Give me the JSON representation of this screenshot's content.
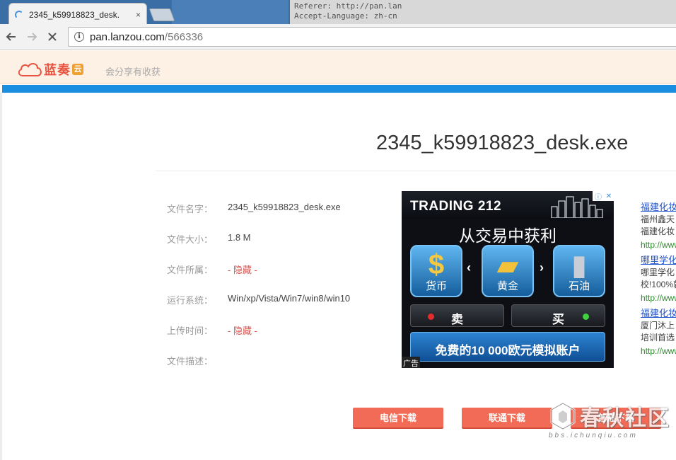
{
  "browser": {
    "tab_title": "2345_k59918823_desk.",
    "tab_close": "×",
    "url_host": "pan.lanzou.com",
    "url_path": "/566336",
    "desktop_text_line1": "Referer: http://pan.lan",
    "desktop_text_line2": "Accept-Language: zh-cn"
  },
  "site": {
    "logo_text": "蓝奏",
    "logo_badge": "云",
    "slogan": "会分享有收获",
    "accent_color": "#1a8ee0"
  },
  "file": {
    "title": "2345_k59918823_desk.exe",
    "rows": [
      {
        "label": "文件名字：",
        "value": "2345_k59918823_desk.exe"
      },
      {
        "label": "文件大小：",
        "value": "1.8 M"
      },
      {
        "label": "文件所属：",
        "value": "- 隐藏 -"
      },
      {
        "label": "运行系统：",
        "value": "Win/xp/Vista/Win7/win8/win10"
      },
      {
        "label": "上传时间：",
        "value": "- 隐藏 -"
      },
      {
        "label": "文件描述：",
        "value": ""
      }
    ]
  },
  "ad": {
    "brand": "TRADING 212",
    "headline": "从交易中获利",
    "tiles": [
      {
        "glyph": "$",
        "label": "货币"
      },
      {
        "glyph": "▰",
        "label": "黄金"
      },
      {
        "glyph": "▮",
        "label": "石油"
      }
    ],
    "sell_label": "卖",
    "buy_label": "买",
    "cta": "免费的10 000欧元模拟账户",
    "tag": "广告",
    "left_arrow": "‹",
    "right_arrow": "›"
  },
  "side_ads": [
    {
      "link": "福建化妆",
      "desc1": "福州鑫天",
      "desc2": "福建化妆",
      "url": "http://www"
    },
    {
      "link": "哪里学化",
      "desc1": "哪里学化",
      "desc2": "校!100%就",
      "url": "http://www"
    },
    {
      "link": "福建化妆",
      "desc1": "厦门沐上",
      "desc2": "培训首选",
      "url": "http://www"
    }
  ],
  "downloads": {
    "telecom": "电信下载",
    "unicom": "联通下载",
    "normal": "普通下载"
  },
  "watermark": {
    "text": "春秋社区",
    "sub": "bbs.ichunqiu.com"
  }
}
